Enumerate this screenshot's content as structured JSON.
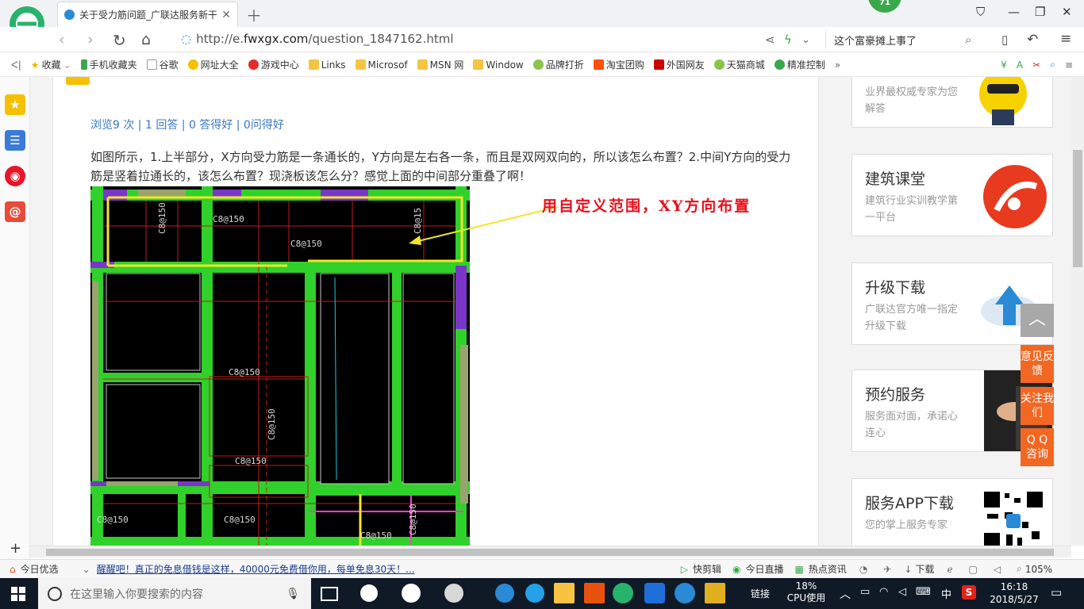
{
  "browser": {
    "tab_title": "关于受力筋问题_广联达服务新干",
    "badge_count": "71",
    "url_prefix": "http://e.",
    "url_domain": "fwxgx.com",
    "url_path": "/question_1847162.html",
    "search_text": "这个富豪摊上事了"
  },
  "bookmarks": [
    "收藏",
    "手机收藏夹",
    "谷歌",
    "网址大全",
    "游戏中心",
    "Links",
    "Microsof",
    "MSN 网",
    "Window",
    "品牌打折",
    "淘宝团购",
    "外国网友",
    "天猫商城",
    "精准控制"
  ],
  "question": {
    "stats": "浏览9 次 | 1 回答 | 0 答得好 | 0问得好",
    "text": "如图所示，1.上半部分，X方向受力筋是一条通长的，Y方向是左右各一条，而且是双网双向的，所以该怎么布置？2.中间Y方向的受力筋是竖着拉通长的，该怎么布置？现浇板该怎么分？感觉上面的中间部分重叠了啊！",
    "annotation": "用自定义范围，XY方向布置",
    "cad_labels": [
      "C8@150",
      "C8@150",
      "C8@150",
      "C8@150",
      "C8@150",
      "C8@150",
      "C8@150",
      "C8@150",
      "C8@150",
      "C8@150",
      "C8@15"
    ]
  },
  "sidebar_cards": [
    {
      "title": "",
      "sub": "业界最权威专家为您解答"
    },
    {
      "title": "建筑课堂",
      "sub": "建筑行业实训教学第一平台"
    },
    {
      "title": "升级下载",
      "sub": "广联达官方唯一指定升级下载"
    },
    {
      "title": "预约服务",
      "sub": "服务面对面，承诺心连心"
    },
    {
      "title": "服务APP下载",
      "sub": "您的掌上服务专家"
    }
  ],
  "side_tabs": [
    "意见反馈",
    "关注我们",
    "Q Q 咨询"
  ],
  "status": {
    "items": [
      "今日优选",
      "醒醒吧！真正的免息借钱是这样，40000元免费借你用，每单免息30天！...",
      "快剪辑",
      "今日直播",
      "热点资讯",
      "下载"
    ],
    "zoom": "105%"
  },
  "taskbar": {
    "search_placeholder": "在这里输入你要搜索的内容",
    "link_label": "链接",
    "cpu_percent": "18%",
    "cpu_label": "CPU使用",
    "ime": "中",
    "time": "16:18",
    "date": "2018/5/27"
  },
  "colors": {
    "accent_green": "#3aa84a",
    "side_orange": "#f26722",
    "link_blue": "#3a78c0",
    "annotation_red": "#e8101c"
  }
}
